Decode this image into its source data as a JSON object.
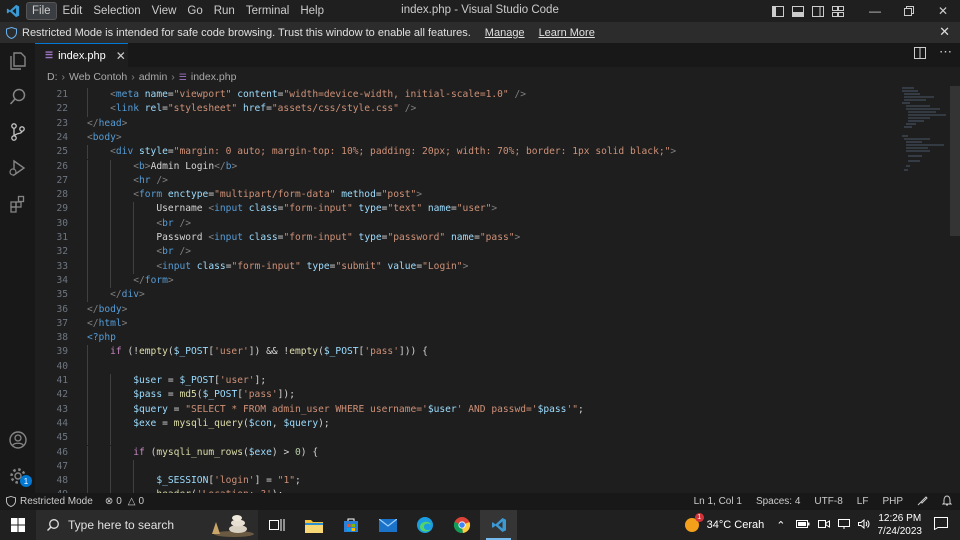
{
  "titlebar": {
    "menu": [
      "File",
      "Edit",
      "Selection",
      "View",
      "Go",
      "Run",
      "Terminal",
      "Help"
    ],
    "window_title": "index.php - Visual Studio Code"
  },
  "banner": {
    "message": "Restricted Mode is intended for safe code browsing. Trust this window to enable all features.",
    "manage_label": "Manage",
    "learn_more_label": "Learn More"
  },
  "tab": {
    "filename": "index.php",
    "icon_text": "php"
  },
  "breadcrumb": [
    "D:",
    "Web Contoh",
    "admin",
    "index.php"
  ],
  "editor": {
    "lines": [
      {
        "n": "21",
        "indent": 2,
        "tokens": [
          [
            "t-punc",
            "<"
          ],
          [
            "t-tag",
            "meta "
          ],
          [
            "t-attr",
            "name"
          ],
          [
            "t-text",
            "="
          ],
          [
            "t-str",
            "\"viewport\""
          ],
          [
            "t-text",
            " "
          ],
          [
            "t-attr",
            "content"
          ],
          [
            "t-text",
            "="
          ],
          [
            "t-str",
            "\"width=device-width, initial-scale=1.0\""
          ],
          [
            "t-text",
            " "
          ],
          [
            "t-punc",
            "/>"
          ]
        ]
      },
      {
        "n": "22",
        "indent": 2,
        "tokens": [
          [
            "t-punc",
            "<"
          ],
          [
            "t-tag",
            "link "
          ],
          [
            "t-attr",
            "rel"
          ],
          [
            "t-text",
            "="
          ],
          [
            "t-str",
            "\"stylesheet\""
          ],
          [
            "t-text",
            " "
          ],
          [
            "t-attr",
            "href"
          ],
          [
            "t-text",
            "="
          ],
          [
            "t-str",
            "\"assets/css/style.css\""
          ],
          [
            "t-text",
            " "
          ],
          [
            "t-punc",
            "/>"
          ]
        ]
      },
      {
        "n": "23",
        "indent": 1,
        "tokens": [
          [
            "t-punc",
            "</"
          ],
          [
            "t-tag",
            "head"
          ],
          [
            "t-punc",
            ">"
          ]
        ]
      },
      {
        "n": "24",
        "indent": 1,
        "tokens": [
          [
            "t-punc",
            "<"
          ],
          [
            "t-tag",
            "body"
          ],
          [
            "t-punc",
            ">"
          ]
        ]
      },
      {
        "n": "25",
        "indent": 2,
        "tokens": [
          [
            "t-punc",
            "<"
          ],
          [
            "t-tag",
            "div "
          ],
          [
            "t-attr",
            "style"
          ],
          [
            "t-text",
            "="
          ],
          [
            "t-str",
            "\"margin: 0 auto; margin-top: 10%; padding: 20px; width: 70%; border: 1px solid black;\""
          ],
          [
            "t-punc",
            ">"
          ]
        ]
      },
      {
        "n": "26",
        "indent": 3,
        "tokens": [
          [
            "t-punc",
            "<"
          ],
          [
            "t-tag",
            "b"
          ],
          [
            "t-punc",
            ">"
          ],
          [
            "t-text",
            "Admin Login"
          ],
          [
            "t-punc",
            "</"
          ],
          [
            "t-tag",
            "b"
          ],
          [
            "t-punc",
            ">"
          ]
        ]
      },
      {
        "n": "27",
        "indent": 3,
        "tokens": [
          [
            "t-punc",
            "<"
          ],
          [
            "t-tag",
            "hr "
          ],
          [
            "t-punc",
            "/>"
          ]
        ]
      },
      {
        "n": "28",
        "indent": 3,
        "tokens": [
          [
            "t-punc",
            "<"
          ],
          [
            "t-tag",
            "form "
          ],
          [
            "t-attr",
            "enctype"
          ],
          [
            "t-text",
            "="
          ],
          [
            "t-str",
            "\"multipart/form-data\""
          ],
          [
            "t-text",
            " "
          ],
          [
            "t-attr",
            "method"
          ],
          [
            "t-text",
            "="
          ],
          [
            "t-str",
            "\"post\""
          ],
          [
            "t-punc",
            ">"
          ]
        ]
      },
      {
        "n": "29",
        "indent": 4,
        "tokens": [
          [
            "t-text",
            "Username "
          ],
          [
            "t-punc",
            "<"
          ],
          [
            "t-tag",
            "input "
          ],
          [
            "t-attr",
            "class"
          ],
          [
            "t-text",
            "="
          ],
          [
            "t-str",
            "\"form-input\""
          ],
          [
            "t-text",
            " "
          ],
          [
            "t-attr",
            "type"
          ],
          [
            "t-text",
            "="
          ],
          [
            "t-str",
            "\"text\""
          ],
          [
            "t-text",
            " "
          ],
          [
            "t-attr",
            "name"
          ],
          [
            "t-text",
            "="
          ],
          [
            "t-str",
            "\"user\""
          ],
          [
            "t-punc",
            ">"
          ]
        ]
      },
      {
        "n": "30",
        "indent": 4,
        "tokens": [
          [
            "t-punc",
            "<"
          ],
          [
            "t-tag",
            "br "
          ],
          [
            "t-punc",
            "/>"
          ]
        ]
      },
      {
        "n": "31",
        "indent": 4,
        "tokens": [
          [
            "t-text",
            "Password "
          ],
          [
            "t-punc",
            "<"
          ],
          [
            "t-tag",
            "input "
          ],
          [
            "t-attr",
            "class"
          ],
          [
            "t-text",
            "="
          ],
          [
            "t-str",
            "\"form-input\""
          ],
          [
            "t-text",
            " "
          ],
          [
            "t-attr",
            "type"
          ],
          [
            "t-text",
            "="
          ],
          [
            "t-str",
            "\"password\""
          ],
          [
            "t-text",
            " "
          ],
          [
            "t-attr",
            "name"
          ],
          [
            "t-text",
            "="
          ],
          [
            "t-str",
            "\"pass\""
          ],
          [
            "t-punc",
            ">"
          ]
        ]
      },
      {
        "n": "32",
        "indent": 4,
        "tokens": [
          [
            "t-punc",
            "<"
          ],
          [
            "t-tag",
            "br "
          ],
          [
            "t-punc",
            "/>"
          ]
        ]
      },
      {
        "n": "33",
        "indent": 4,
        "tokens": [
          [
            "t-punc",
            "<"
          ],
          [
            "t-tag",
            "input "
          ],
          [
            "t-attr",
            "class"
          ],
          [
            "t-text",
            "="
          ],
          [
            "t-str",
            "\"form-input\""
          ],
          [
            "t-text",
            " "
          ],
          [
            "t-attr",
            "type"
          ],
          [
            "t-text",
            "="
          ],
          [
            "t-str",
            "\"submit\""
          ],
          [
            "t-text",
            " "
          ],
          [
            "t-attr",
            "value"
          ],
          [
            "t-text",
            "="
          ],
          [
            "t-str",
            "\"Login\""
          ],
          [
            "t-punc",
            ">"
          ]
        ]
      },
      {
        "n": "34",
        "indent": 3,
        "tokens": [
          [
            "t-punc",
            "</"
          ],
          [
            "t-tag",
            "form"
          ],
          [
            "t-punc",
            ">"
          ]
        ]
      },
      {
        "n": "35",
        "indent": 2,
        "tokens": [
          [
            "t-punc",
            "</"
          ],
          [
            "t-tag",
            "div"
          ],
          [
            "t-punc",
            ">"
          ]
        ]
      },
      {
        "n": "36",
        "indent": 1,
        "tokens": [
          [
            "t-punc",
            "</"
          ],
          [
            "t-tag",
            "body"
          ],
          [
            "t-punc",
            ">"
          ]
        ]
      },
      {
        "n": "37",
        "indent": 1,
        "tokens": [
          [
            "t-punc",
            "</"
          ],
          [
            "t-tag",
            "html"
          ],
          [
            "t-punc",
            ">"
          ]
        ]
      },
      {
        "n": "38",
        "indent": 1,
        "tokens": [
          [
            "t-php",
            "<?php"
          ]
        ]
      },
      {
        "n": "39",
        "indent": 2,
        "tokens": [
          [
            "t-kw",
            "if"
          ],
          [
            "t-text",
            " (!"
          ],
          [
            "t-fn",
            "empty"
          ],
          [
            "t-text",
            "("
          ],
          [
            "t-var",
            "$_POST"
          ],
          [
            "t-text",
            "["
          ],
          [
            "t-str",
            "'user'"
          ],
          [
            "t-text",
            "]) && !"
          ],
          [
            "t-fn",
            "empty"
          ],
          [
            "t-text",
            "("
          ],
          [
            "t-var",
            "$_POST"
          ],
          [
            "t-text",
            "["
          ],
          [
            "t-str",
            "'pass'"
          ],
          [
            "t-text",
            "])) {"
          ]
        ]
      },
      {
        "n": "40",
        "indent": 2,
        "tokens": []
      },
      {
        "n": "41",
        "indent": 3,
        "tokens": [
          [
            "t-var",
            "$user"
          ],
          [
            "t-text",
            " = "
          ],
          [
            "t-var",
            "$_POST"
          ],
          [
            "t-text",
            "["
          ],
          [
            "t-str",
            "'user'"
          ],
          [
            "t-text",
            "];"
          ]
        ]
      },
      {
        "n": "42",
        "indent": 3,
        "tokens": [
          [
            "t-var",
            "$pass"
          ],
          [
            "t-text",
            " = "
          ],
          [
            "t-fn",
            "md5"
          ],
          [
            "t-text",
            "("
          ],
          [
            "t-var",
            "$_POST"
          ],
          [
            "t-text",
            "["
          ],
          [
            "t-str",
            "'pass'"
          ],
          [
            "t-text",
            "]);"
          ]
        ]
      },
      {
        "n": "43",
        "indent": 3,
        "tokens": [
          [
            "t-var",
            "$query"
          ],
          [
            "t-text",
            " = "
          ],
          [
            "t-str",
            "\"SELECT * FROM admin_user WHERE username='"
          ],
          [
            "t-var",
            "$user"
          ],
          [
            "t-str",
            "' AND passwd='"
          ],
          [
            "t-var",
            "$pass"
          ],
          [
            "t-str",
            "'\""
          ],
          [
            "t-text",
            ";"
          ]
        ]
      },
      {
        "n": "44",
        "indent": 3,
        "tokens": [
          [
            "t-var",
            "$exe"
          ],
          [
            "t-text",
            " = "
          ],
          [
            "t-fn",
            "mysqli_query"
          ],
          [
            "t-text",
            "("
          ],
          [
            "t-var",
            "$con"
          ],
          [
            "t-text",
            ", "
          ],
          [
            "t-var",
            "$query"
          ],
          [
            "t-text",
            ");"
          ]
        ]
      },
      {
        "n": "45",
        "indent": 3,
        "tokens": []
      },
      {
        "n": "46",
        "indent": 3,
        "tokens": [
          [
            "t-kw",
            "if"
          ],
          [
            "t-text",
            " ("
          ],
          [
            "t-fn",
            "mysqli_num_rows"
          ],
          [
            "t-text",
            "("
          ],
          [
            "t-var",
            "$exe"
          ],
          [
            "t-text",
            ") > "
          ],
          [
            "t-num",
            "0"
          ],
          [
            "t-text",
            ") {"
          ]
        ]
      },
      {
        "n": "47",
        "indent": 4,
        "tokens": []
      },
      {
        "n": "48",
        "indent": 4,
        "tokens": [
          [
            "t-var",
            "$_SESSION"
          ],
          [
            "t-text",
            "["
          ],
          [
            "t-str",
            "'login'"
          ],
          [
            "t-text",
            "] = "
          ],
          [
            "t-str",
            "\"1\""
          ],
          [
            "t-text",
            ";"
          ]
        ]
      },
      {
        "n": "49",
        "indent": 4,
        "tokens": [
          [
            "t-fn",
            "header"
          ],
          [
            "t-text",
            "("
          ],
          [
            "t-str",
            "'Location: ?'"
          ],
          [
            "t-text",
            ");"
          ]
        ]
      }
    ]
  },
  "statusbar": {
    "restricted": "Restricted Mode",
    "errors": "0",
    "warnings": "0",
    "position": "Ln 1, Col 1",
    "spaces": "Spaces: 4",
    "encoding": "UTF-8",
    "eol": "LF",
    "language": "PHP"
  },
  "taskbar": {
    "search_placeholder": "Type here to search",
    "weather": "34°C  Cerah",
    "time": "12:26 PM",
    "date": "7/24/2023",
    "weather_badge": "1"
  },
  "activity": {
    "accounts_badge": "1"
  },
  "colors": {
    "accent": "#0078d4",
    "editor_bg": "#1e1e1e"
  }
}
